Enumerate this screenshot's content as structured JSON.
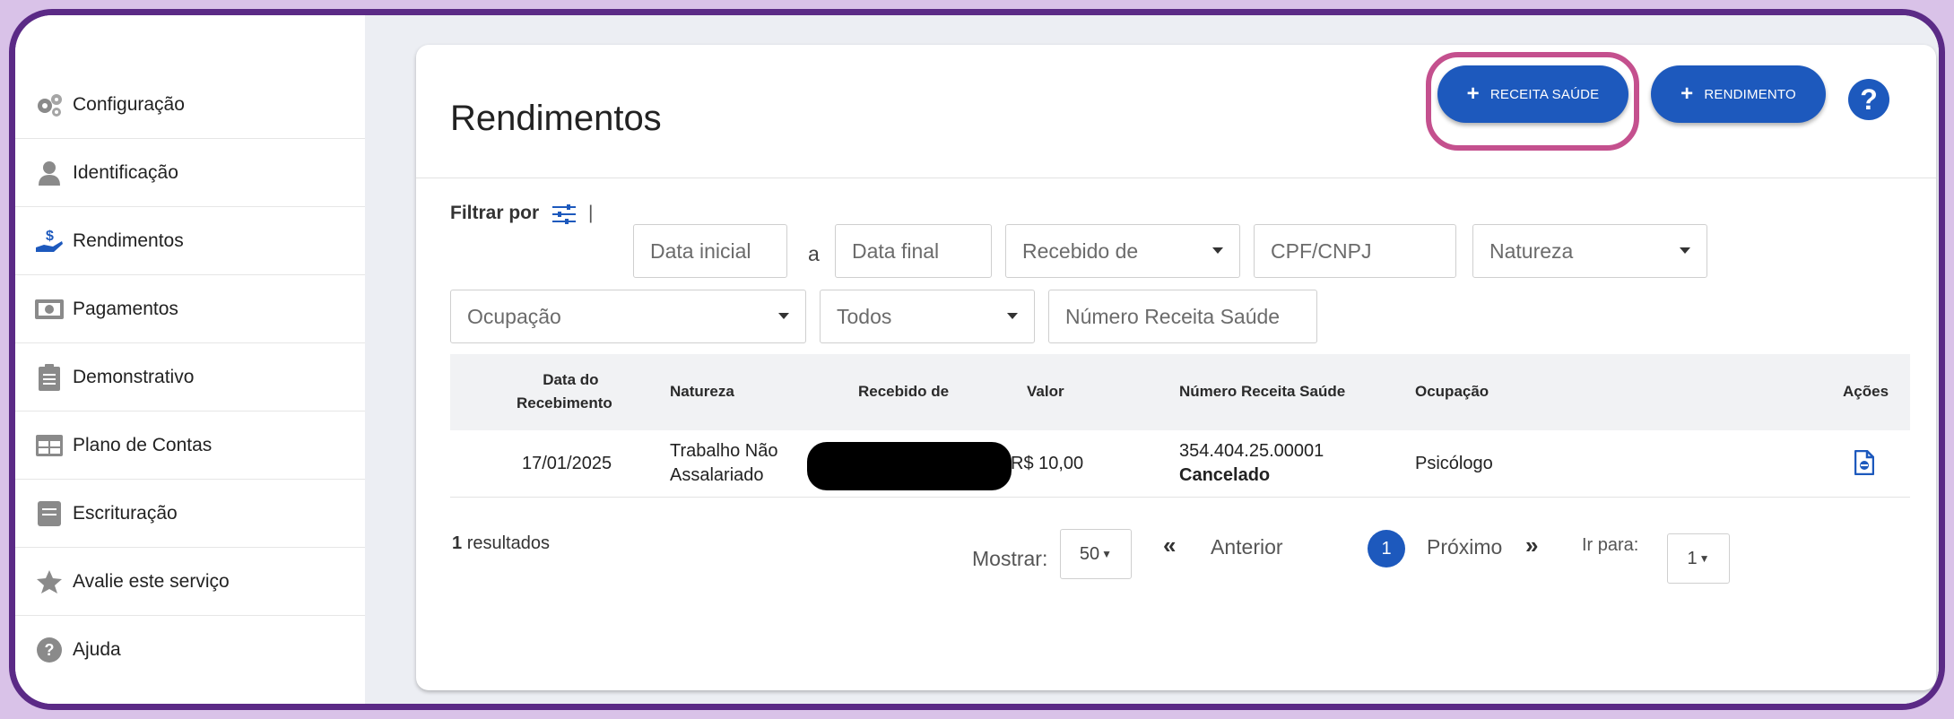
{
  "sidebar": {
    "items": [
      {
        "label": "Configuração",
        "icon": "gears-icon"
      },
      {
        "label": "Identificação",
        "icon": "user-icon"
      },
      {
        "label": "Rendimentos",
        "icon": "income-hand-icon"
      },
      {
        "label": "Pagamentos",
        "icon": "banknote-icon"
      },
      {
        "label": "Demonstrativo",
        "icon": "clipboard-icon"
      },
      {
        "label": "Plano de Contas",
        "icon": "table-icon"
      },
      {
        "label": "Escrituração",
        "icon": "book-icon"
      },
      {
        "label": "Avalie este serviço",
        "icon": "star-icon"
      },
      {
        "label": "Ajuda",
        "icon": "help-icon"
      }
    ]
  },
  "header": {
    "title": "Rendimentos",
    "btn_receita": "RECEITA SAÚDE",
    "btn_rendimento": "RENDIMENTO",
    "plus": "+",
    "help": "?"
  },
  "filters": {
    "label": "Filtrar por",
    "separator": "|",
    "connector": "a",
    "data_inicial": "Data inicial",
    "data_final": "Data final",
    "recebido_de": "Recebido de",
    "cpf_cnpj": "CPF/CNPJ",
    "natureza": "Natureza",
    "ocupacao": "Ocupação",
    "status": "Todos",
    "numero_receita": "Número Receita Saúde"
  },
  "table": {
    "headers": {
      "data_line1": "Data do",
      "data_line2": "Recebimento",
      "natureza": "Natureza",
      "recebido": "Recebido de",
      "valor": "Valor",
      "numero": "Número Receita Saúde",
      "ocupacao": "Ocupação",
      "acoes": "Ações"
    },
    "rows": [
      {
        "data": "17/01/2025",
        "natureza_line1": "Trabalho Não",
        "natureza_line2": "Assalariado",
        "valor": "R$ 10,00",
        "numero": "354.404.25.00001",
        "status": "Cancelado",
        "ocupacao": "Psicólogo"
      }
    ]
  },
  "pagination": {
    "results_count": "1",
    "results_label": "resultados",
    "mostrar_label": "Mostrar:",
    "mostrar_value": "50",
    "prev_chev": "«",
    "anterior": "Anterior",
    "current_page": "1",
    "proximo": "Próximo",
    "next_chev": "»",
    "ir_para_label": "Ir para:",
    "ir_para_value": "1"
  },
  "colors": {
    "primary": "#1d59bd",
    "highlight": "#c4508e",
    "frame": "#5b2a86"
  }
}
